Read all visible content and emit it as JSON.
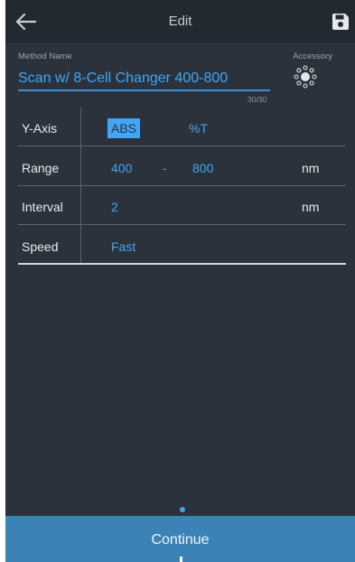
{
  "header": {
    "title": "Edit",
    "icons": {
      "back": "back-arrow-icon",
      "save": "save-floppy-icon"
    }
  },
  "method": {
    "label": "Method Name",
    "value": "Scan w/ 8-Cell Changer 400-800",
    "counter": "30/30"
  },
  "accessory": {
    "label": "Accessory",
    "icon": "cell-changer-icon"
  },
  "params": {
    "y_axis": {
      "label": "Y-Axis",
      "options": [
        "ABS",
        "%T"
      ],
      "selected": "ABS"
    },
    "range": {
      "label": "Range",
      "start": "400",
      "separator": "-",
      "end": "800",
      "unit": "nm"
    },
    "interval": {
      "label": "Interval",
      "value": "2",
      "unit": "nm"
    },
    "speed": {
      "label": "Speed",
      "value": "Fast"
    }
  },
  "footer": {
    "continue_label": "Continue"
  },
  "colors": {
    "accent": "#42a5f5",
    "background": "#2b323b",
    "topbar": "#222930",
    "continue_bar": "#3b83b7"
  }
}
